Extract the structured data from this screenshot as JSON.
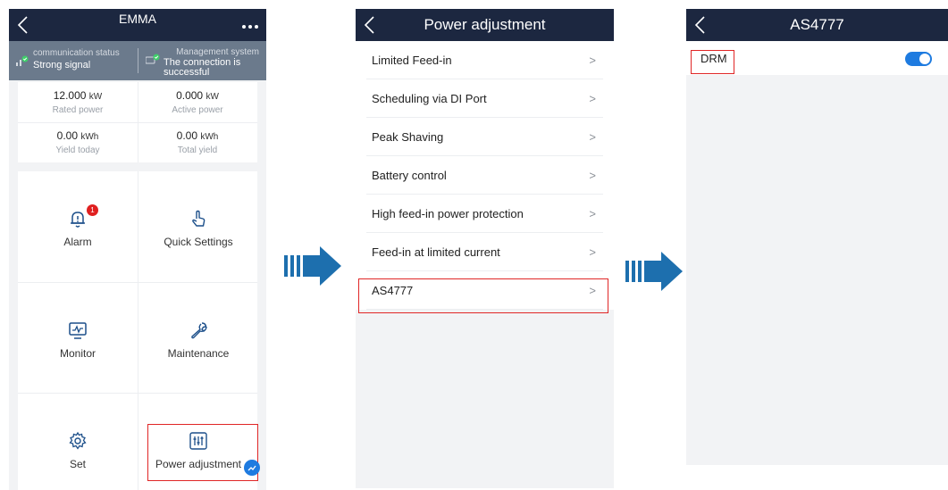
{
  "screen1": {
    "title": "EMMA",
    "status": {
      "communication_label": "communication status",
      "communication_value": "Strong signal",
      "management_label": "Management system",
      "management_value_line1": "The connection is",
      "management_value_line2": "successful"
    },
    "kpis": [
      {
        "value": "12.000",
        "unit": "kW",
        "caption": "Rated power"
      },
      {
        "value": "0.000",
        "unit": "kW",
        "caption": "Active power"
      },
      {
        "value": "0.00",
        "unit": "kWh",
        "caption": "Yield today"
      },
      {
        "value": "0.00",
        "unit": "kWh",
        "caption": "Total yield"
      }
    ],
    "tiles": {
      "alarm": {
        "label": "Alarm",
        "badge": "1",
        "icon": "bell-icon"
      },
      "quick_settings": {
        "label": "Quick Settings",
        "icon": "hand-pointer-icon"
      },
      "monitor": {
        "label": "Monitor",
        "icon": "monitor-icon"
      },
      "maintenance": {
        "label": "Maintenance",
        "icon": "wrench-icon"
      },
      "set": {
        "label": "Set",
        "icon": "gear-icon"
      },
      "power_adjustment": {
        "label": "Power adjustment",
        "icon": "sliders-icon"
      }
    }
  },
  "screen2": {
    "title": "Power adjustment",
    "items": [
      {
        "label": "Limited Feed-in",
        "chevron": ">"
      },
      {
        "label": "Scheduling via DI Port",
        "chevron": ">"
      },
      {
        "label": "Peak Shaving",
        "chevron": ">"
      },
      {
        "label": "Battery control",
        "chevron": ">"
      },
      {
        "label": "High feed-in power protection",
        "chevron": ">"
      },
      {
        "label": "Feed-in at limited current",
        "chevron": ">"
      },
      {
        "label": "AS4777",
        "chevron": ">"
      }
    ]
  },
  "screen3": {
    "title": "AS4777",
    "drm_label": "DRM",
    "drm_enabled": true
  },
  "colors": {
    "navbar": "#1c2740",
    "status_bar": "#6b7a8c",
    "accent_blue": "#1e7be0",
    "highlight_red": "#e02626",
    "arrow_blue": "#1d6fae",
    "success_green": "#3fcf6a"
  }
}
